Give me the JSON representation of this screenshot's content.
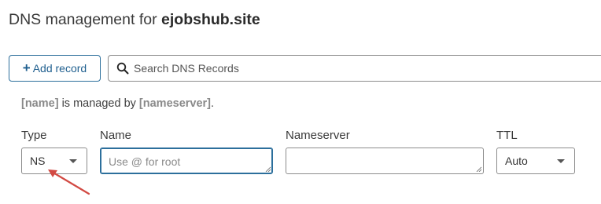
{
  "header": {
    "title_prefix": "DNS management for ",
    "domain": "ejobshub.site"
  },
  "toolbar": {
    "add_icon": "+",
    "add_label": "Add record",
    "search_placeholder": "Search DNS Records",
    "search_icon": "search-icon"
  },
  "notice": {
    "name_token": "[name]",
    "middle": " is managed by ",
    "nameserver_token": "[nameserver]",
    "end": "."
  },
  "form": {
    "type_label": "Type",
    "type_value": "NS",
    "name_label": "Name",
    "name_placeholder": "Use @ for root",
    "nameserver_label": "Nameserver",
    "nameserver_value": "",
    "ttl_label": "TTL",
    "ttl_value": "Auto"
  },
  "colors": {
    "accent": "#2c6f9c",
    "annotation_arrow": "#d24a43"
  }
}
